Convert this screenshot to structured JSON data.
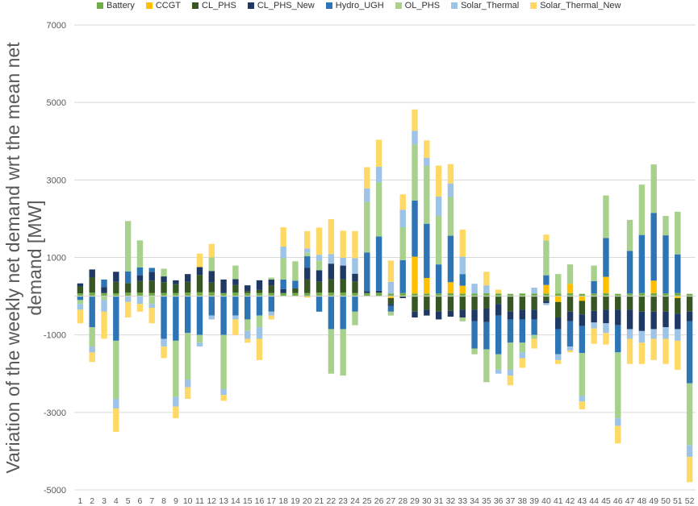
{
  "chart_data": {
    "type": "bar",
    "stacked": true,
    "ylabel": "Variation of the weekly net demand wrt the mean net demand [MW]",
    "xlabel": "",
    "title": "",
    "ylim": [
      -5000,
      7000
    ],
    "yticks": [
      -5000,
      -3000,
      -1000,
      1000,
      3000,
      5000,
      7000
    ],
    "grid": "horizontal",
    "legend_position": "top",
    "categories": [
      "1",
      "2",
      "3",
      "4",
      "5",
      "6",
      "7",
      "8",
      "9",
      "10",
      "11",
      "12",
      "13",
      "14",
      "15",
      "16",
      "17",
      "18",
      "19",
      "20",
      "21",
      "22",
      "23",
      "24",
      "25",
      "26",
      "27",
      "28",
      "29",
      "30",
      "31",
      "32",
      "33",
      "34",
      "35",
      "36",
      "37",
      "38",
      "39",
      "40",
      "41",
      "42",
      "43",
      "44",
      "45",
      "46",
      "47",
      "48",
      "49",
      "50",
      "51",
      "52"
    ],
    "series": [
      {
        "name": "Battery",
        "color": "#70ad47",
        "values": [
          70,
          90,
          80,
          70,
          90,
          90,
          80,
          80,
          80,
          90,
          100,
          100,
          80,
          90,
          80,
          80,
          80,
          80,
          80,
          80,
          90,
          90,
          90,
          80,
          80,
          90,
          70,
          80,
          70,
          70,
          70,
          80,
          70,
          70,
          80,
          70,
          60,
          70,
          70,
          70,
          70,
          80,
          60,
          70,
          80,
          60,
          70,
          80,
          80,
          70,
          80,
          60
        ]
      },
      {
        "name": "CCGT",
        "color": "#ffc000",
        "values": [
          0,
          0,
          0,
          0,
          0,
          0,
          0,
          0,
          0,
          0,
          0,
          0,
          0,
          0,
          0,
          0,
          0,
          0,
          0,
          -30,
          0,
          0,
          0,
          0,
          0,
          0,
          -50,
          0,
          950,
          400,
          0,
          280,
          200,
          0,
          0,
          0,
          0,
          0,
          0,
          220,
          -150,
          240,
          -120,
          0,
          420,
          0,
          0,
          0,
          320,
          0,
          -50,
          0
        ]
      },
      {
        "name": "CL_PHS",
        "color": "#375623",
        "values": [
          180,
          400,
          0,
          300,
          250,
          300,
          320,
          280,
          230,
          280,
          450,
          250,
          0,
          200,
          50,
          80,
          200,
          0,
          120,
          350,
          280,
          350,
          350,
          300,
          0,
          0,
          -150,
          0,
          -400,
          -350,
          -400,
          -380,
          -350,
          -350,
          -320,
          -200,
          -400,
          -350,
          -350,
          -120,
          -400,
          -400,
          -350,
          -380,
          -350,
          -350,
          -350,
          -400,
          -400,
          -400,
          -400,
          -400
        ]
      },
      {
        "name": "CL_PHS_New",
        "color": "#203864",
        "values": [
          80,
          200,
          150,
          260,
          0,
          150,
          230,
          150,
          100,
          200,
          200,
          300,
          350,
          150,
          150,
          250,
          150,
          100,
          0,
          300,
          300,
          400,
          350,
          200,
          50,
          50,
          -50,
          -50,
          -150,
          -150,
          -200,
          -150,
          -200,
          -300,
          -350,
          -300,
          -200,
          -250,
          -250,
          -60,
          -300,
          -250,
          -300,
          -300,
          -350,
          -400,
          -500,
          -500,
          -450,
          -400,
          -400,
          -250
        ]
      },
      {
        "name": "Hydro_UGH",
        "color": "#2e75b6",
        "values": [
          -100,
          -800,
          200,
          -1150,
          300,
          200,
          100,
          -1100,
          -1150,
          -950,
          -1000,
          -500,
          -1000,
          -500,
          -600,
          -500,
          -400,
          250,
          200,
          300,
          -400,
          -850,
          -850,
          -400,
          1000,
          1400,
          -150,
          850,
          1450,
          1400,
          750,
          1200,
          300,
          -700,
          -700,
          -1000,
          -600,
          -600,
          -400,
          250,
          -650,
          -650,
          -700,
          320,
          1000,
          -700,
          1100,
          1500,
          1750,
          1500,
          1000,
          -1600
        ]
      },
      {
        "name": "OL_PHS",
        "color": "#a9d18e",
        "values": [
          -100,
          -500,
          -100,
          -1500,
          1300,
          700,
          -200,
          200,
          -1450,
          -1200,
          -200,
          350,
          -1400,
          350,
          -300,
          -300,
          50,
          550,
          500,
          100,
          250,
          -1150,
          -1200,
          -350,
          1300,
          1400,
          -100,
          850,
          1450,
          1500,
          1250,
          1000,
          -100,
          -150,
          -850,
          -400,
          -700,
          -250,
          -100,
          900,
          500,
          500,
          -1100,
          400,
          1100,
          -1700,
          800,
          1300,
          1250,
          500,
          1100,
          -1600
        ]
      },
      {
        "name": "Solar_Thermal",
        "color": "#9dc3e6",
        "values": [
          -150,
          -150,
          -300,
          -250,
          -150,
          -200,
          -100,
          -200,
          -250,
          -200,
          -100,
          -100,
          -150,
          -100,
          -200,
          -300,
          -100,
          300,
          0,
          100,
          150,
          250,
          200,
          400,
          350,
          400,
          300,
          450,
          350,
          200,
          500,
          350,
          450,
          250,
          200,
          -100,
          -150,
          -150,
          150,
          -50,
          -150,
          -100,
          -150,
          -150,
          -250,
          -200,
          -250,
          -300,
          -250,
          -300,
          -300,
          -300
        ]
      },
      {
        "name": "Solar_Thermal_New",
        "color": "#ffd966",
        "values": [
          -350,
          -250,
          -700,
          -600,
          -400,
          -200,
          -400,
          -300,
          -300,
          -300,
          350,
          350,
          -150,
          -400,
          -100,
          -550,
          -100,
          500,
          0,
          450,
          700,
          900,
          700,
          700,
          550,
          700,
          550,
          400,
          550,
          450,
          800,
          500,
          700,
          0,
          350,
          100,
          -250,
          -250,
          -250,
          150,
          -100,
          -50,
          -200,
          -400,
          -300,
          -450,
          -650,
          -550,
          -550,
          -650,
          -750,
          -650
        ]
      }
    ]
  }
}
